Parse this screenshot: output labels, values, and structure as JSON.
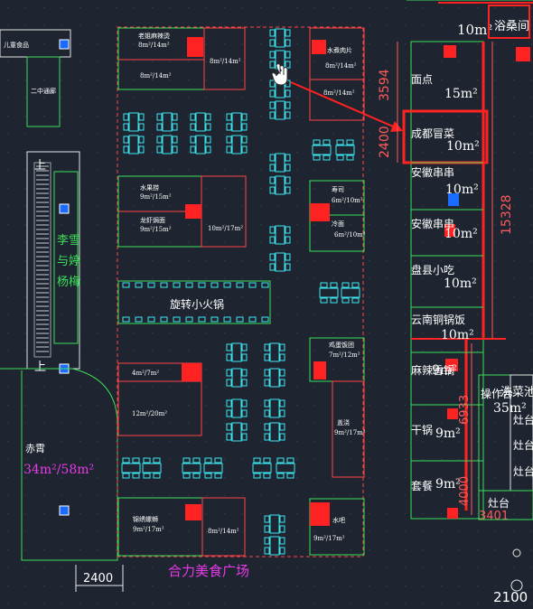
{
  "plan": {
    "top_left_label": "儿童食品",
    "top_room": "浴桑间",
    "corridor_label": "二中通廊",
    "escalator_up_1": "上",
    "escalator_up_2": "上",
    "vertical_text": [
      "李雪",
      "与婷",
      "杨梅"
    ],
    "left_shop_name": "赤霄",
    "left_shop_area": "34m²/58m²",
    "dim_top_room": "10m²",
    "bottom_title": "合力美食广场",
    "rotating_hotpot": "旋转小火锅",
    "dims": {
      "d2400_bottom": "2400",
      "d2100": "2100",
      "d3594": "3594",
      "d2400_v": "2400",
      "d15328": "15328",
      "d6933": "6933",
      "d4000": "4000",
      "d3401": "3401"
    },
    "left_stalls": [
      {
        "name": "老姐麻辣烫",
        "area": "8m²/14m²"
      },
      {
        "name": "8m²/14m²",
        "area": ""
      },
      {
        "name": "8m²/14m²",
        "area": ""
      },
      {
        "name": "水果捞",
        "area": "9m²/15m²"
      },
      {
        "name": "龙虾焗面",
        "area": "9m²/15m²"
      },
      {
        "name": "10m²/17m²",
        "area": ""
      },
      {
        "name": "4m²/7m²",
        "area": ""
      },
      {
        "name": "12m²/20m²",
        "area": ""
      },
      {
        "name": "锦绣螺蛳",
        "area": "9m²/17m²"
      },
      {
        "name": "8m²/14m²",
        "area": ""
      }
    ],
    "mid_stalls": [
      {
        "name": "水煮肉片",
        "area": "8m²/14m²"
      },
      {
        "name": "8m²/14m²",
        "area": ""
      },
      {
        "name": "寿司",
        "area": "6m²/10m²"
      },
      {
        "name": "冷面",
        "area": "6m²/10m²"
      },
      {
        "name": "鸡蛋饭团",
        "area": "7m²/12m²"
      },
      {
        "name": "盖浇",
        "area": "9m²/17m²"
      },
      {
        "name": "水吧",
        "area": "9m²/17m²"
      }
    ],
    "right_stalls": [
      {
        "name": "面点",
        "area": "15m²"
      },
      {
        "name": "成都冒菜",
        "area": "10m²"
      },
      {
        "name": "安徽串串",
        "area": "10m²"
      },
      {
        "name": "安徽串串",
        "area": "10m²"
      },
      {
        "name": "盘县小吃",
        "area": "10m²"
      },
      {
        "name": "云南铜锅饭",
        "area": "10m²"
      },
      {
        "name": "麻辣香锅",
        "area": "9m²"
      },
      {
        "name": "干锅",
        "area": "9m²"
      },
      {
        "name": "套餐",
        "area": "9m²"
      }
    ],
    "far_right": {
      "wash_label": "洗菜池",
      "ops_label": "操作台",
      "ops_area": "35m²",
      "counters": [
        "灶台",
        "灶台",
        "灶台"
      ],
      "bottom_counter": "灶台"
    }
  },
  "colors": {
    "background": "#1f2530",
    "wall_green": "#3adf5a",
    "furniture_cyan": "#3ee8f0",
    "highlight_red": "#ff2222",
    "label_magenta": "#e83ae8",
    "marker_blue": "#1a6bff"
  }
}
